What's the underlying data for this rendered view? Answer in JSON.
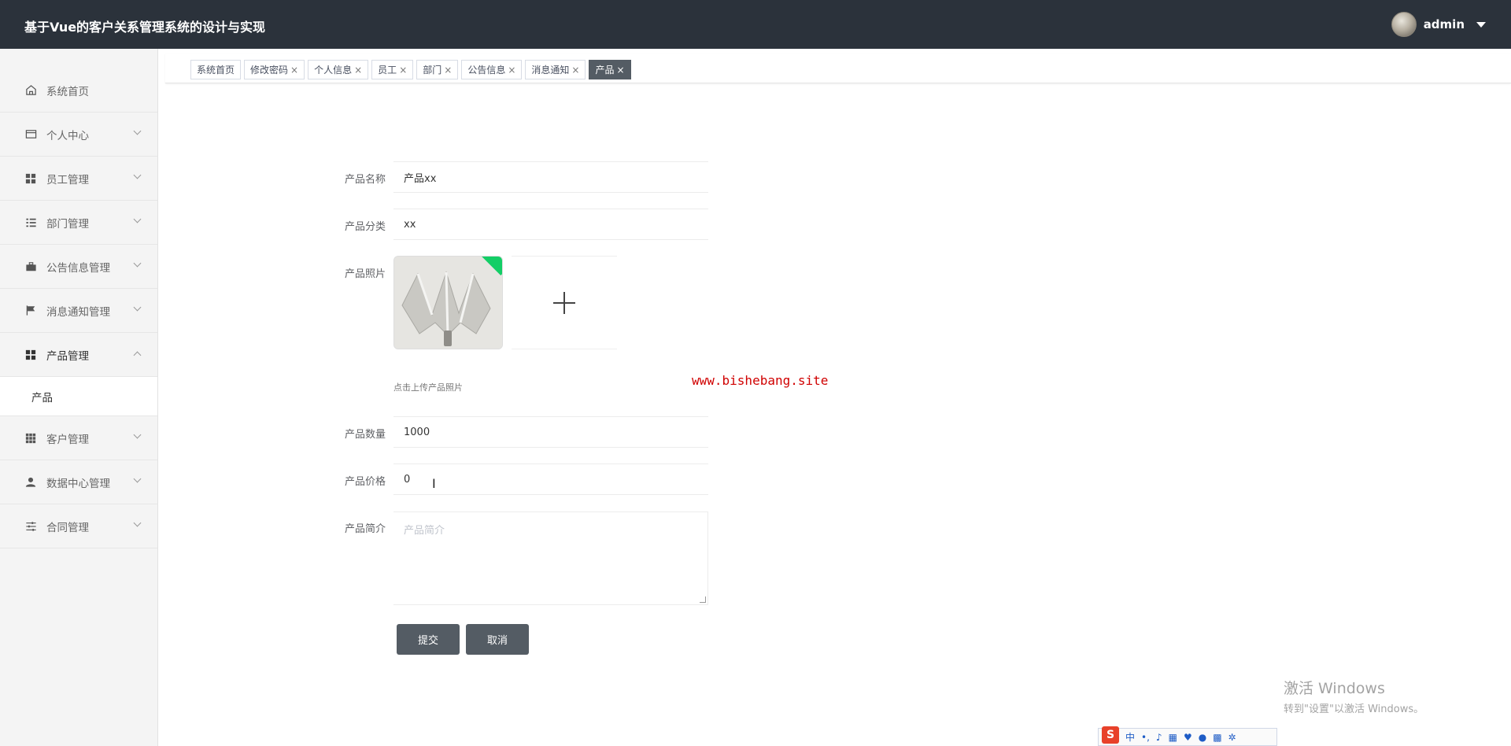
{
  "header": {
    "title": "基于Vue的客户关系管理系统的设计与实现",
    "username": "admin"
  },
  "sidebar": {
    "items": [
      {
        "label": "系统首页",
        "icon": "home-icon"
      },
      {
        "label": "个人中心",
        "icon": "wallet-icon"
      },
      {
        "label": "员工管理",
        "icon": "grid-icon"
      },
      {
        "label": "部门管理",
        "icon": "list-icon"
      },
      {
        "label": "公告信息管理",
        "icon": "briefcase-icon"
      },
      {
        "label": "消息通知管理",
        "icon": "flag-icon"
      },
      {
        "label": "产品管理",
        "icon": "grid-icon"
      },
      {
        "label": "客户管理",
        "icon": "apps-icon"
      },
      {
        "label": "数据中心管理",
        "icon": "user-icon"
      },
      {
        "label": "合同管理",
        "icon": "sliders-icon"
      }
    ],
    "submenu": {
      "label": "产品"
    }
  },
  "tabs": [
    {
      "label": "系统首页",
      "closable": false
    },
    {
      "label": "修改密码",
      "closable": true
    },
    {
      "label": "个人信息",
      "closable": true
    },
    {
      "label": "员工",
      "closable": true
    },
    {
      "label": "部门",
      "closable": true
    },
    {
      "label": "公告信息",
      "closable": true
    },
    {
      "label": "消息通知",
      "closable": true
    },
    {
      "label": "产品",
      "closable": true,
      "active": true
    }
  ],
  "form": {
    "name_label": "产品名称",
    "name_value": "产品xx",
    "category_label": "产品分类",
    "category_value": "xx",
    "photo_label": "产品照片",
    "upload_tip": "点击上传产品照片",
    "quantity_label": "产品数量",
    "quantity_value": "1000",
    "price_label": "产品价格",
    "price_value": "0",
    "intro_label": "产品简介",
    "intro_placeholder": "产品简介",
    "submit_label": "提交",
    "cancel_label": "取消"
  },
  "watermark": "www.bishebang.site",
  "windows": {
    "line1": "激活 Windows",
    "line2": "转到\"设置\"以激活 Windows。"
  },
  "ime": {
    "logo": "S",
    "mode": "中"
  },
  "colors": {
    "header_bg": "#2b323b",
    "button_bg": "#545c64",
    "upload_success": "#13ce66",
    "watermark": "#d00000"
  }
}
